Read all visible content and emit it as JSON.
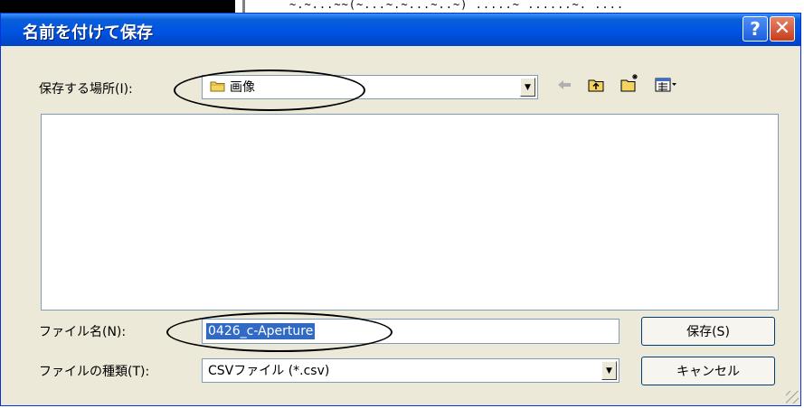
{
  "background": {
    "snippet": "~.~...~~(~...~.~...~..~)   .....~   ......~.  ...."
  },
  "dialog": {
    "title": "名前を付けて保存",
    "help_label": "?",
    "close_label": "✕"
  },
  "save_in": {
    "label": "保存する場所(I):",
    "value": "画像"
  },
  "toolbar": {
    "back_icon": "back-arrow-icon",
    "up_icon": "up-folder-icon",
    "new_folder_icon": "new-folder-icon",
    "view_menu_icon": "view-menu-icon"
  },
  "file_name": {
    "label": "ファイル名(N):",
    "value": "0426_c-Aperture"
  },
  "file_type": {
    "label": "ファイルの種類(T):",
    "value": "CSVファイル (*.csv)"
  },
  "buttons": {
    "save": "保存(S)",
    "cancel": "キャンセル"
  },
  "colors": {
    "titlebar": "#0054e3",
    "dialog_bg": "#ece9d8",
    "selection": "#316ac5",
    "close_button": "#c73c1c"
  }
}
